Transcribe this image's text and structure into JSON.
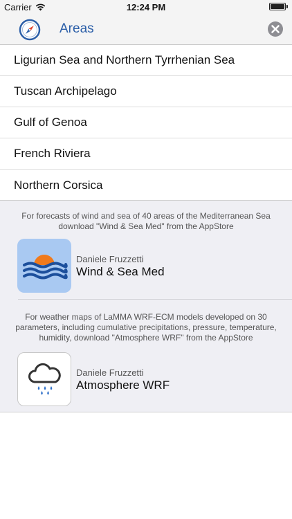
{
  "status_bar": {
    "carrier": "Carrier",
    "time": "12:24 PM",
    "battery_level": 1.0
  },
  "nav": {
    "title": "Areas",
    "left_icon": "compass-icon",
    "right_icon": "close-circle-icon",
    "accent_color": "#2c5fa8"
  },
  "areas": [
    {
      "label": "Ligurian Sea and Northern Tyrrhenian Sea"
    },
    {
      "label": "Tuscan Archipelago"
    },
    {
      "label": "Gulf of Genoa"
    },
    {
      "label": "French Riviera"
    },
    {
      "label": "Northern Corsica"
    }
  ],
  "promos": [
    {
      "text": "For forecasts of wind and sea of 40 areas of the Mediterranean Sea download \"Wind & Sea Med\" from the AppStore",
      "developer": "Daniele Fruzzetti",
      "app_name": "Wind & Sea Med",
      "icon": "wind-sea-app-icon"
    },
    {
      "text": "For weather maps of LaMMA WRF-ECM models developed on 30 parameters, including cumulative precipitations, pressure, temperature, humidity, download \"Atmosphere WRF\" from the AppStore",
      "developer": "Daniele Fruzzetti",
      "app_name": "Atmosphere WRF",
      "icon": "atmosphere-app-icon"
    }
  ]
}
